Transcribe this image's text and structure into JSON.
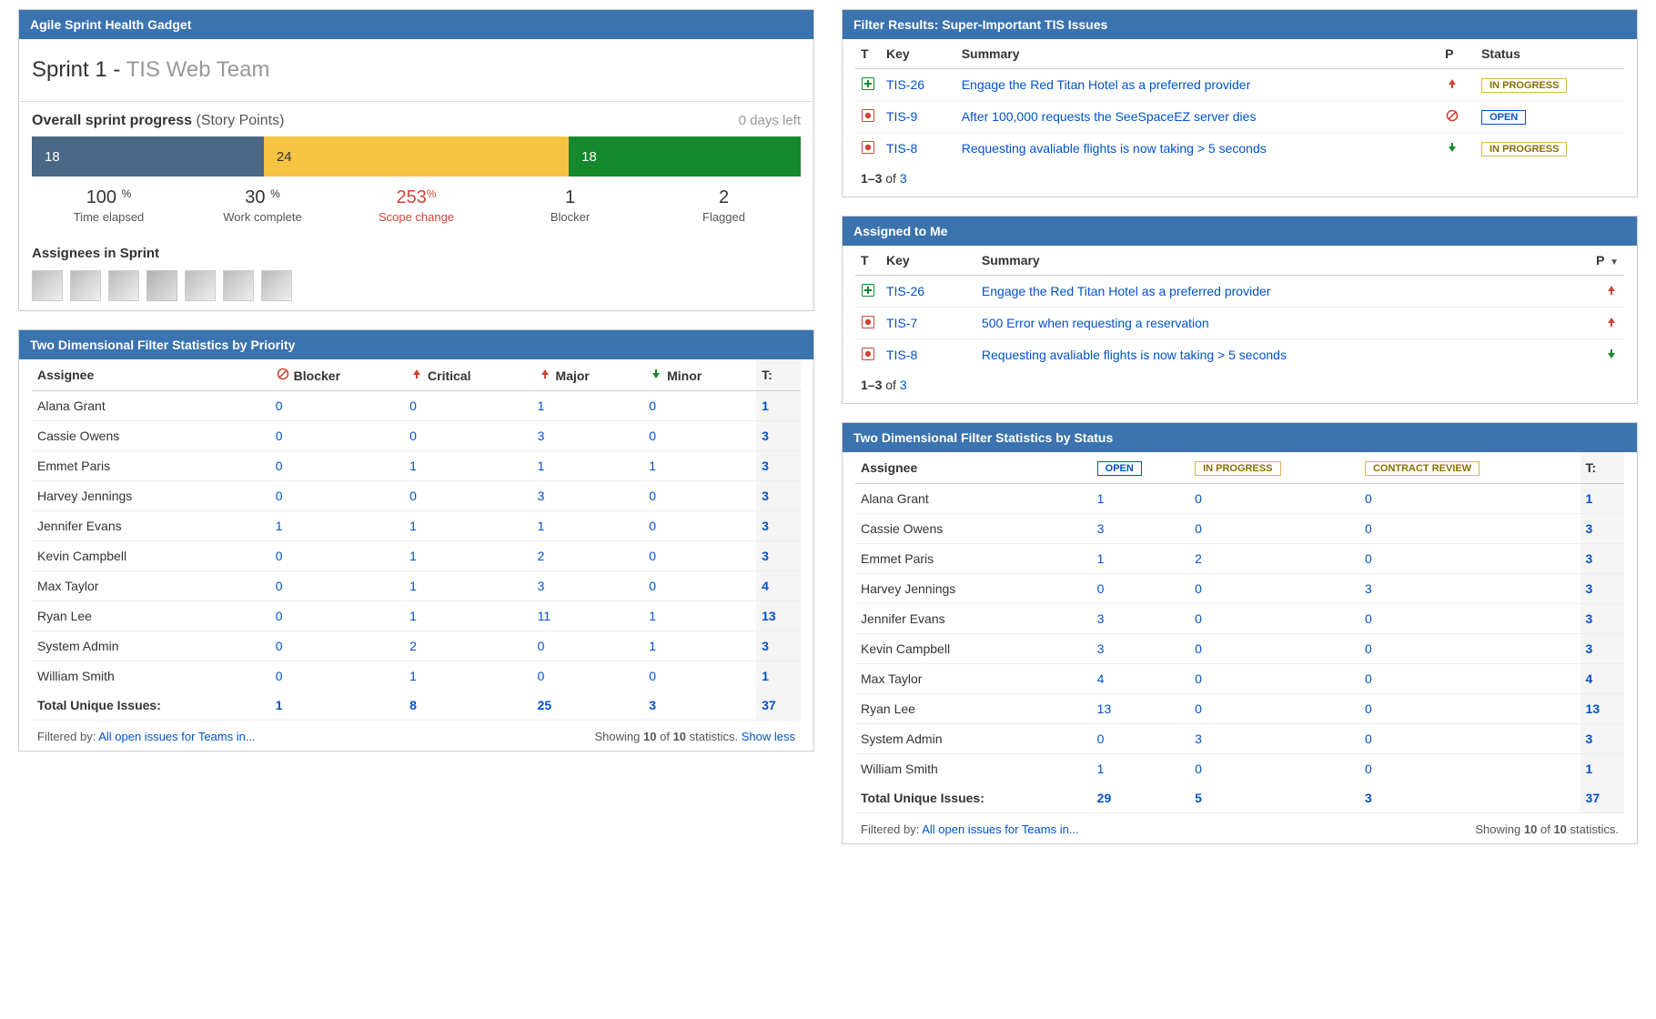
{
  "sprint_health": {
    "title": "Agile Sprint Health Gadget",
    "sprint_name": "Sprint 1",
    "team_name": "TIS Web Team",
    "progress_label": "Overall sprint progress",
    "progress_unit": "(Story Points)",
    "days_left": "0 days left",
    "segments": {
      "done": "18",
      "inprog": "24",
      "todo": "18"
    },
    "metrics": {
      "time_elapsed": {
        "value": "100",
        "pct": "%",
        "label": "Time elapsed"
      },
      "work_complete": {
        "value": "30",
        "pct": "%",
        "label": "Work complete"
      },
      "scope_change": {
        "value": "253",
        "pct": "%",
        "label": "Scope change"
      },
      "blocker": {
        "value": "1",
        "label": "Blocker"
      },
      "flagged": {
        "value": "2",
        "label": "Flagged"
      }
    },
    "assignees_label": "Assignees in Sprint",
    "avatar_count": 7
  },
  "priority_stats": {
    "title": "Two Dimensional Filter Statistics by Priority",
    "columns": {
      "assignee": "Assignee",
      "blocker": "Blocker",
      "critical": "Critical",
      "major": "Major",
      "minor": "Minor",
      "total": "T:"
    },
    "rows": [
      {
        "name": "Alana Grant",
        "blocker": "0",
        "critical": "0",
        "major": "1",
        "minor": "0",
        "total": "1"
      },
      {
        "name": "Cassie Owens",
        "blocker": "0",
        "critical": "0",
        "major": "3",
        "minor": "0",
        "total": "3"
      },
      {
        "name": "Emmet Paris",
        "blocker": "0",
        "critical": "1",
        "major": "1",
        "minor": "1",
        "total": "3"
      },
      {
        "name": "Harvey Jennings",
        "blocker": "0",
        "critical": "0",
        "major": "3",
        "minor": "0",
        "total": "3"
      },
      {
        "name": "Jennifer Evans",
        "blocker": "1",
        "critical": "1",
        "major": "1",
        "minor": "0",
        "total": "3"
      },
      {
        "name": "Kevin Campbell",
        "blocker": "0",
        "critical": "1",
        "major": "2",
        "minor": "0",
        "total": "3"
      },
      {
        "name": "Max Taylor",
        "blocker": "0",
        "critical": "1",
        "major": "3",
        "minor": "0",
        "total": "4"
      },
      {
        "name": "Ryan Lee",
        "blocker": "0",
        "critical": "1",
        "major": "11",
        "minor": "1",
        "total": "13"
      },
      {
        "name": "System Admin",
        "blocker": "0",
        "critical": "2",
        "major": "0",
        "minor": "1",
        "total": "3"
      },
      {
        "name": "William Smith",
        "blocker": "0",
        "critical": "1",
        "major": "0",
        "minor": "0",
        "total": "1"
      }
    ],
    "totals_label": "Total Unique Issues:",
    "totals": {
      "blocker": "1",
      "critical": "8",
      "major": "25",
      "minor": "3",
      "total": "37"
    },
    "footer": {
      "filtered_label": "Filtered by:",
      "filter_link": "All open issues for Teams in...",
      "showing_a": "Showing",
      "showing_b": "10",
      "showing_c": "of",
      "showing_d": "10",
      "showing_e": "statistics.",
      "show_less": "Show less"
    }
  },
  "filter_results": {
    "title": "Filter Results: Super-Important TIS Issues",
    "columns": {
      "t": "T",
      "key": "Key",
      "summary": "Summary",
      "p": "P",
      "status": "Status"
    },
    "rows": [
      {
        "type": "add",
        "key": "TIS-26",
        "summary": "Engage the Red Titan Hotel as a preferred provider",
        "prio": "up-red",
        "status": "IN PROGRESS",
        "status_class": "status-inprog"
      },
      {
        "type": "bug",
        "key": "TIS-9",
        "summary": "After 100,000 requests the SeeSpaceEZ server dies",
        "prio": "block",
        "status": "OPEN",
        "status_class": "status-open"
      },
      {
        "type": "bug",
        "key": "TIS-8",
        "summary": "Requesting avaliable flights is now taking > 5 seconds",
        "prio": "down-green",
        "status": "IN PROGRESS",
        "status_class": "status-inprog"
      }
    ],
    "pagination_a": "1–3",
    "pagination_b": "of",
    "pagination_c": "3"
  },
  "assigned_to_me": {
    "title": "Assigned to Me",
    "columns": {
      "t": "T",
      "key": "Key",
      "summary": "Summary",
      "p": "P"
    },
    "rows": [
      {
        "type": "add",
        "key": "TIS-26",
        "summary": "Engage the Red Titan Hotel as a preferred provider",
        "prio": "up-red"
      },
      {
        "type": "bug",
        "key": "TIS-7",
        "summary": "500 Error when requesting a reservation",
        "prio": "up-red"
      },
      {
        "type": "bug",
        "key": "TIS-8",
        "summary": "Requesting avaliable flights is now taking > 5 seconds",
        "prio": "down-green"
      }
    ],
    "pagination_a": "1–3",
    "pagination_b": "of",
    "pagination_c": "3"
  },
  "status_stats": {
    "title": "Two Dimensional Filter Statistics by Status",
    "columns": {
      "assignee": "Assignee",
      "open": "OPEN",
      "inprog": "IN PROGRESS",
      "contract": "CONTRACT REVIEW",
      "total": "T:"
    },
    "rows": [
      {
        "name": "Alana Grant",
        "open": "1",
        "inprog": "0",
        "contract": "0",
        "total": "1"
      },
      {
        "name": "Cassie Owens",
        "open": "3",
        "inprog": "0",
        "contract": "0",
        "total": "3"
      },
      {
        "name": "Emmet Paris",
        "open": "1",
        "inprog": "2",
        "contract": "0",
        "total": "3"
      },
      {
        "name": "Harvey Jennings",
        "open": "0",
        "inprog": "0",
        "contract": "3",
        "total": "3"
      },
      {
        "name": "Jennifer Evans",
        "open": "3",
        "inprog": "0",
        "contract": "0",
        "total": "3"
      },
      {
        "name": "Kevin Campbell",
        "open": "3",
        "inprog": "0",
        "contract": "0",
        "total": "3"
      },
      {
        "name": "Max Taylor",
        "open": "4",
        "inprog": "0",
        "contract": "0",
        "total": "4"
      },
      {
        "name": "Ryan Lee",
        "open": "13",
        "inprog": "0",
        "contract": "0",
        "total": "13"
      },
      {
        "name": "System Admin",
        "open": "0",
        "inprog": "3",
        "contract": "0",
        "total": "3"
      },
      {
        "name": "William Smith",
        "open": "1",
        "inprog": "0",
        "contract": "0",
        "total": "1"
      }
    ],
    "totals_label": "Total Unique Issues:",
    "totals": {
      "open": "29",
      "inprog": "5",
      "contract": "3",
      "total": "37"
    },
    "footer": {
      "filtered_label": "Filtered by:",
      "filter_link": "All open issues for Teams in...",
      "showing_a": "Showing",
      "showing_b": "10",
      "showing_c": "of",
      "showing_d": "10",
      "showing_e": "statistics."
    }
  }
}
